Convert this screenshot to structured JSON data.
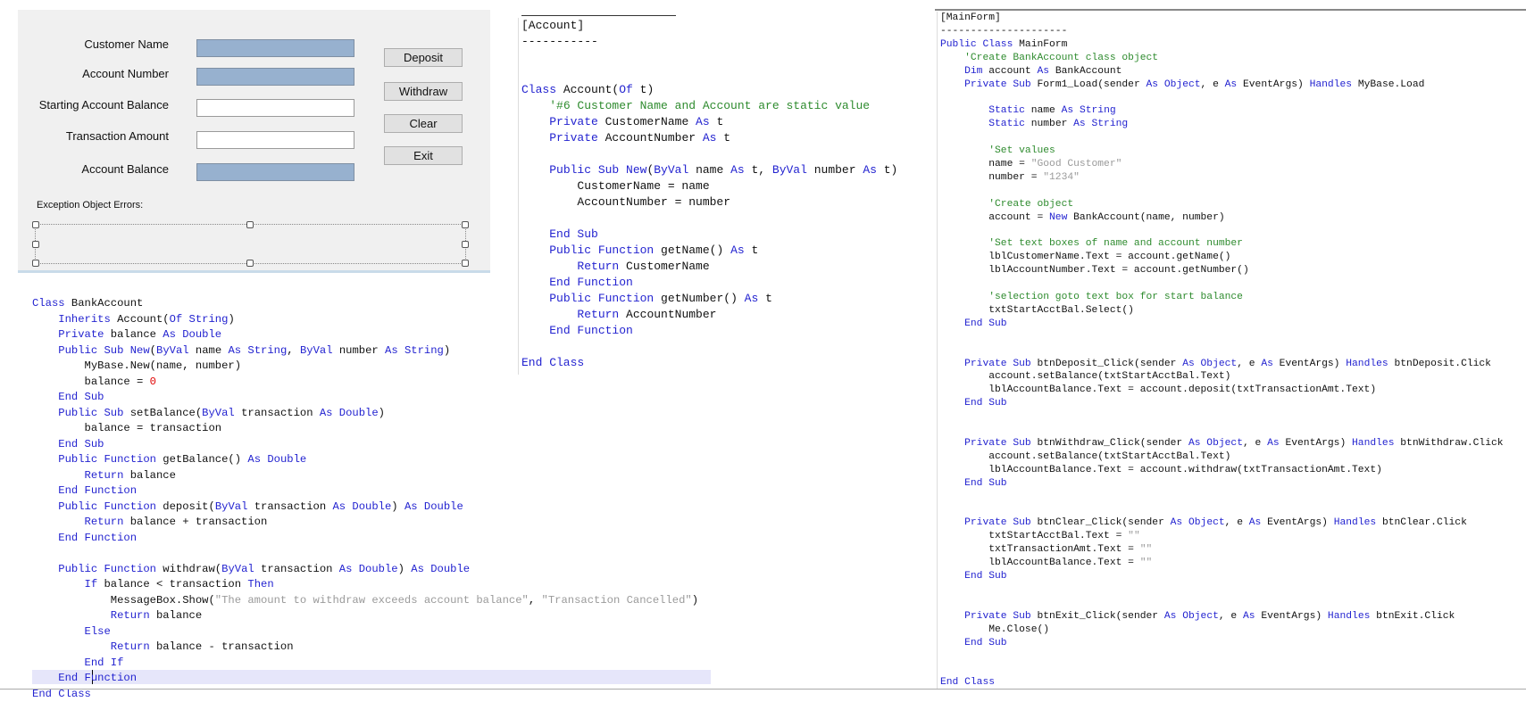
{
  "form": {
    "labels": {
      "customer_name": "Customer Name",
      "account_number": "Account Number",
      "starting_balance": "Starting Account Balance",
      "transaction_amount": "Transaction Amount",
      "account_balance": "Account Balance",
      "exception_errors": "Exception Object Errors:"
    },
    "buttons": {
      "deposit": "Deposit",
      "withdraw": "Withdraw",
      "clear": "Clear",
      "exit": "Exit"
    }
  },
  "code": {
    "bank_account": [
      [
        [
          "k",
          "Class"
        ],
        [
          "p",
          " BankAccount"
        ]
      ],
      [
        [
          "p",
          "    "
        ],
        [
          "k",
          "Inherits"
        ],
        [
          "p",
          " Account("
        ],
        [
          "k",
          "Of String"
        ],
        [
          "p",
          ")"
        ]
      ],
      [
        [
          "p",
          "    "
        ],
        [
          "k",
          "Private"
        ],
        [
          "p",
          " balance "
        ],
        [
          "k",
          "As Double"
        ]
      ],
      [
        [
          "p",
          "    "
        ],
        [
          "k",
          "Public Sub New"
        ],
        [
          "p",
          "("
        ],
        [
          "k",
          "ByVal"
        ],
        [
          "p",
          " name "
        ],
        [
          "k",
          "As String"
        ],
        [
          "p",
          ", "
        ],
        [
          "k",
          "ByVal"
        ],
        [
          "p",
          " number "
        ],
        [
          "k",
          "As String"
        ],
        [
          "p",
          ")"
        ]
      ],
      [
        [
          "p",
          "        MyBase.New(name, number)"
        ]
      ],
      [
        [
          "p",
          "        balance = "
        ],
        [
          "n",
          "0"
        ]
      ],
      [
        [
          "p",
          "    "
        ],
        [
          "k",
          "End Sub"
        ]
      ],
      [
        [
          "p",
          "    "
        ],
        [
          "k",
          "Public Sub"
        ],
        [
          "p",
          " setBalance("
        ],
        [
          "k",
          "ByVal"
        ],
        [
          "p",
          " transaction "
        ],
        [
          "k",
          "As Double"
        ],
        [
          "p",
          ")"
        ]
      ],
      [
        [
          "p",
          "        balance = transaction"
        ]
      ],
      [
        [
          "p",
          "    "
        ],
        [
          "k",
          "End Sub"
        ]
      ],
      [
        [
          "p",
          "    "
        ],
        [
          "k",
          "Public Function"
        ],
        [
          "p",
          " getBalance() "
        ],
        [
          "k",
          "As Double"
        ]
      ],
      [
        [
          "p",
          "        "
        ],
        [
          "k",
          "Return"
        ],
        [
          "p",
          " balance"
        ]
      ],
      [
        [
          "p",
          "    "
        ],
        [
          "k",
          "End Function"
        ]
      ],
      [
        [
          "p",
          "    "
        ],
        [
          "k",
          "Public Function"
        ],
        [
          "p",
          " deposit("
        ],
        [
          "k",
          "ByVal"
        ],
        [
          "p",
          " transaction "
        ],
        [
          "k",
          "As Double"
        ],
        [
          "p",
          ") "
        ],
        [
          "k",
          "As Double"
        ]
      ],
      [
        [
          "p",
          "        "
        ],
        [
          "k",
          "Return"
        ],
        [
          "p",
          " balance + transaction"
        ]
      ],
      [
        [
          "p",
          "    "
        ],
        [
          "k",
          "End Function"
        ]
      ],
      [
        [
          "p",
          " "
        ]
      ],
      [
        [
          "p",
          "    "
        ],
        [
          "k",
          "Public Function"
        ],
        [
          "p",
          " withdraw("
        ],
        [
          "k",
          "ByVal"
        ],
        [
          "p",
          " transaction "
        ],
        [
          "k",
          "As Double"
        ],
        [
          "p",
          ") "
        ],
        [
          "k",
          "As Double"
        ]
      ],
      [
        [
          "p",
          "        "
        ],
        [
          "k",
          "If"
        ],
        [
          "p",
          " balance < transaction "
        ],
        [
          "k",
          "Then"
        ]
      ],
      [
        [
          "p",
          "            MessageBox.Show("
        ],
        [
          "s",
          "\"The amount to withdraw exceeds account balance\""
        ],
        [
          "p",
          ", "
        ],
        [
          "s",
          "\"Transaction Cancelled\""
        ],
        [
          "p",
          ")"
        ]
      ],
      [
        [
          "p",
          "            "
        ],
        [
          "k",
          "Return"
        ],
        [
          "p",
          " balance"
        ]
      ],
      [
        [
          "p",
          "        "
        ],
        [
          "k",
          "Else"
        ]
      ],
      [
        [
          "p",
          "            "
        ],
        [
          "k",
          "Return"
        ],
        [
          "p",
          " balance - transaction"
        ]
      ],
      [
        [
          "p",
          "        "
        ],
        [
          "k",
          "End If"
        ]
      ],
      [
        [
          "p",
          "    "
        ],
        [
          "k",
          "End Function"
        ]
      ],
      [
        [
          "k",
          "End Class"
        ]
      ]
    ],
    "account": [
      [
        [
          "p",
          "[Account]"
        ]
      ],
      [
        [
          "p",
          "-----------"
        ]
      ],
      [
        [
          "p",
          " "
        ]
      ],
      [
        [
          "p",
          " "
        ]
      ],
      [
        [
          "k",
          "Class"
        ],
        [
          "p",
          " Account("
        ],
        [
          "k",
          "Of"
        ],
        [
          "p",
          " t)"
        ]
      ],
      [
        [
          "p",
          "    "
        ],
        [
          "c",
          "'#6 Customer Name and Account are static value"
        ]
      ],
      [
        [
          "p",
          "    "
        ],
        [
          "k",
          "Private"
        ],
        [
          "p",
          " CustomerName "
        ],
        [
          "k",
          "As"
        ],
        [
          "p",
          " t"
        ]
      ],
      [
        [
          "p",
          "    "
        ],
        [
          "k",
          "Private"
        ],
        [
          "p",
          " AccountNumber "
        ],
        [
          "k",
          "As"
        ],
        [
          "p",
          " t"
        ]
      ],
      [
        [
          "p",
          " "
        ]
      ],
      [
        [
          "p",
          "    "
        ],
        [
          "k",
          "Public Sub New"
        ],
        [
          "p",
          "("
        ],
        [
          "k",
          "ByVal"
        ],
        [
          "p",
          " name "
        ],
        [
          "k",
          "As"
        ],
        [
          "p",
          " t, "
        ],
        [
          "k",
          "ByVal"
        ],
        [
          "p",
          " number "
        ],
        [
          "k",
          "As"
        ],
        [
          "p",
          " t)"
        ]
      ],
      [
        [
          "p",
          "        CustomerName = name"
        ]
      ],
      [
        [
          "p",
          "        AccountNumber = number"
        ]
      ],
      [
        [
          "p",
          " "
        ]
      ],
      [
        [
          "p",
          "    "
        ],
        [
          "k",
          "End Sub"
        ]
      ],
      [
        [
          "p",
          "    "
        ],
        [
          "k",
          "Public Function"
        ],
        [
          "p",
          " getName() "
        ],
        [
          "k",
          "As"
        ],
        [
          "p",
          " t"
        ]
      ],
      [
        [
          "p",
          "        "
        ],
        [
          "k",
          "Return"
        ],
        [
          "p",
          " CustomerName"
        ]
      ],
      [
        [
          "p",
          "    "
        ],
        [
          "k",
          "End Function"
        ]
      ],
      [
        [
          "p",
          "    "
        ],
        [
          "k",
          "Public Function"
        ],
        [
          "p",
          " getNumber() "
        ],
        [
          "k",
          "As"
        ],
        [
          "p",
          " t"
        ]
      ],
      [
        [
          "p",
          "        "
        ],
        [
          "k",
          "Return"
        ],
        [
          "p",
          " AccountNumber"
        ]
      ],
      [
        [
          "p",
          "    "
        ],
        [
          "k",
          "End Function"
        ]
      ],
      [
        [
          "p",
          " "
        ]
      ],
      [
        [
          "k",
          "End Class"
        ]
      ]
    ],
    "main_form": [
      [
        [
          "p",
          "[MainForm]"
        ]
      ],
      [
        [
          "p",
          "---------------------"
        ]
      ],
      [
        [
          "k",
          "Public Class"
        ],
        [
          "p",
          " MainForm"
        ]
      ],
      [
        [
          "p",
          "    "
        ],
        [
          "c",
          "'Create BankAccount class object"
        ]
      ],
      [
        [
          "p",
          "    "
        ],
        [
          "k",
          "Dim"
        ],
        [
          "p",
          " account "
        ],
        [
          "k",
          "As"
        ],
        [
          "p",
          " BankAccount"
        ]
      ],
      [
        [
          "p",
          "    "
        ],
        [
          "k",
          "Private Sub"
        ],
        [
          "p",
          " Form1_Load(sender "
        ],
        [
          "k",
          "As Object"
        ],
        [
          "p",
          ", e "
        ],
        [
          "k",
          "As"
        ],
        [
          "p",
          " EventArgs) "
        ],
        [
          "k",
          "Handles"
        ],
        [
          "p",
          " MyBase.Load"
        ]
      ],
      [
        [
          "p",
          " "
        ]
      ],
      [
        [
          "p",
          "        "
        ],
        [
          "k",
          "Static"
        ],
        [
          "p",
          " name "
        ],
        [
          "k",
          "As String"
        ]
      ],
      [
        [
          "p",
          "        "
        ],
        [
          "k",
          "Static"
        ],
        [
          "p",
          " number "
        ],
        [
          "k",
          "As String"
        ]
      ],
      [
        [
          "p",
          " "
        ]
      ],
      [
        [
          "p",
          "        "
        ],
        [
          "c",
          "'Set values"
        ]
      ],
      [
        [
          "p",
          "        name = "
        ],
        [
          "s",
          "\"Good Customer\""
        ]
      ],
      [
        [
          "p",
          "        number = "
        ],
        [
          "s",
          "\"1234\""
        ]
      ],
      [
        [
          "p",
          " "
        ]
      ],
      [
        [
          "p",
          "        "
        ],
        [
          "c",
          "'Create object"
        ]
      ],
      [
        [
          "p",
          "        account = "
        ],
        [
          "k",
          "New"
        ],
        [
          "p",
          " BankAccount(name, number)"
        ]
      ],
      [
        [
          "p",
          " "
        ]
      ],
      [
        [
          "p",
          "        "
        ],
        [
          "c",
          "'Set text boxes of name and account number"
        ]
      ],
      [
        [
          "p",
          "        lblCustomerName.Text = account.getName()"
        ]
      ],
      [
        [
          "p",
          "        lblAccountNumber.Text = account.getNumber()"
        ]
      ],
      [
        [
          "p",
          " "
        ]
      ],
      [
        [
          "p",
          "        "
        ],
        [
          "c",
          "'selection goto text box for start balance"
        ]
      ],
      [
        [
          "p",
          "        txtStartAcctBal.Select()"
        ]
      ],
      [
        [
          "p",
          "    "
        ],
        [
          "k",
          "End Sub"
        ]
      ],
      [
        [
          "p",
          " "
        ]
      ],
      [
        [
          "p",
          " "
        ]
      ],
      [
        [
          "p",
          "    "
        ],
        [
          "k",
          "Private Sub"
        ],
        [
          "p",
          " btnDeposit_Click(sender "
        ],
        [
          "k",
          "As Object"
        ],
        [
          "p",
          ", e "
        ],
        [
          "k",
          "As"
        ],
        [
          "p",
          " EventArgs) "
        ],
        [
          "k",
          "Handles"
        ],
        [
          "p",
          " btnDeposit.Click"
        ]
      ],
      [
        [
          "p",
          "        account.setBalance(txtStartAcctBal.Text)"
        ]
      ],
      [
        [
          "p",
          "        lblAccountBalance.Text = account.deposit(txtTransactionAmt.Text)"
        ]
      ],
      [
        [
          "p",
          "    "
        ],
        [
          "k",
          "End Sub"
        ]
      ],
      [
        [
          "p",
          " "
        ]
      ],
      [
        [
          "p",
          " "
        ]
      ],
      [
        [
          "p",
          "    "
        ],
        [
          "k",
          "Private Sub"
        ],
        [
          "p",
          " btnWithdraw_Click(sender "
        ],
        [
          "k",
          "As Object"
        ],
        [
          "p",
          ", e "
        ],
        [
          "k",
          "As"
        ],
        [
          "p",
          " EventArgs) "
        ],
        [
          "k",
          "Handles"
        ],
        [
          "p",
          " btnWithdraw.Click"
        ]
      ],
      [
        [
          "p",
          "        account.setBalance(txtStartAcctBal.Text)"
        ]
      ],
      [
        [
          "p",
          "        lblAccountBalance.Text = account.withdraw(txtTransactionAmt.Text)"
        ]
      ],
      [
        [
          "p",
          "    "
        ],
        [
          "k",
          "End Sub"
        ]
      ],
      [
        [
          "p",
          " "
        ]
      ],
      [
        [
          "p",
          " "
        ]
      ],
      [
        [
          "p",
          "    "
        ],
        [
          "k",
          "Private Sub"
        ],
        [
          "p",
          " btnClear_Click(sender "
        ],
        [
          "k",
          "As Object"
        ],
        [
          "p",
          ", e "
        ],
        [
          "k",
          "As"
        ],
        [
          "p",
          " EventArgs) "
        ],
        [
          "k",
          "Handles"
        ],
        [
          "p",
          " btnClear.Click"
        ]
      ],
      [
        [
          "p",
          "        txtStartAcctBal.Text = "
        ],
        [
          "s",
          "\"\""
        ]
      ],
      [
        [
          "p",
          "        txtTransactionAmt.Text = "
        ],
        [
          "s",
          "\"\""
        ]
      ],
      [
        [
          "p",
          "        lblAccountBalance.Text = "
        ],
        [
          "s",
          "\"\""
        ]
      ],
      [
        [
          "p",
          "    "
        ],
        [
          "k",
          "End Sub"
        ]
      ],
      [
        [
          "p",
          " "
        ]
      ],
      [
        [
          "p",
          " "
        ]
      ],
      [
        [
          "p",
          "    "
        ],
        [
          "k",
          "Private Sub"
        ],
        [
          "p",
          " btnExit_Click(sender "
        ],
        [
          "k",
          "As Object"
        ],
        [
          "p",
          ", e "
        ],
        [
          "k",
          "As"
        ],
        [
          "p",
          " EventArgs) "
        ],
        [
          "k",
          "Handles"
        ],
        [
          "p",
          " btnExit.Click"
        ]
      ],
      [
        [
          "p",
          "        Me.Close()"
        ]
      ],
      [
        [
          "p",
          "    "
        ],
        [
          "k",
          "End Sub"
        ]
      ],
      [
        [
          "p",
          " "
        ]
      ],
      [
        [
          "p",
          " "
        ]
      ],
      [
        [
          "k",
          "End Class"
        ]
      ]
    ]
  }
}
